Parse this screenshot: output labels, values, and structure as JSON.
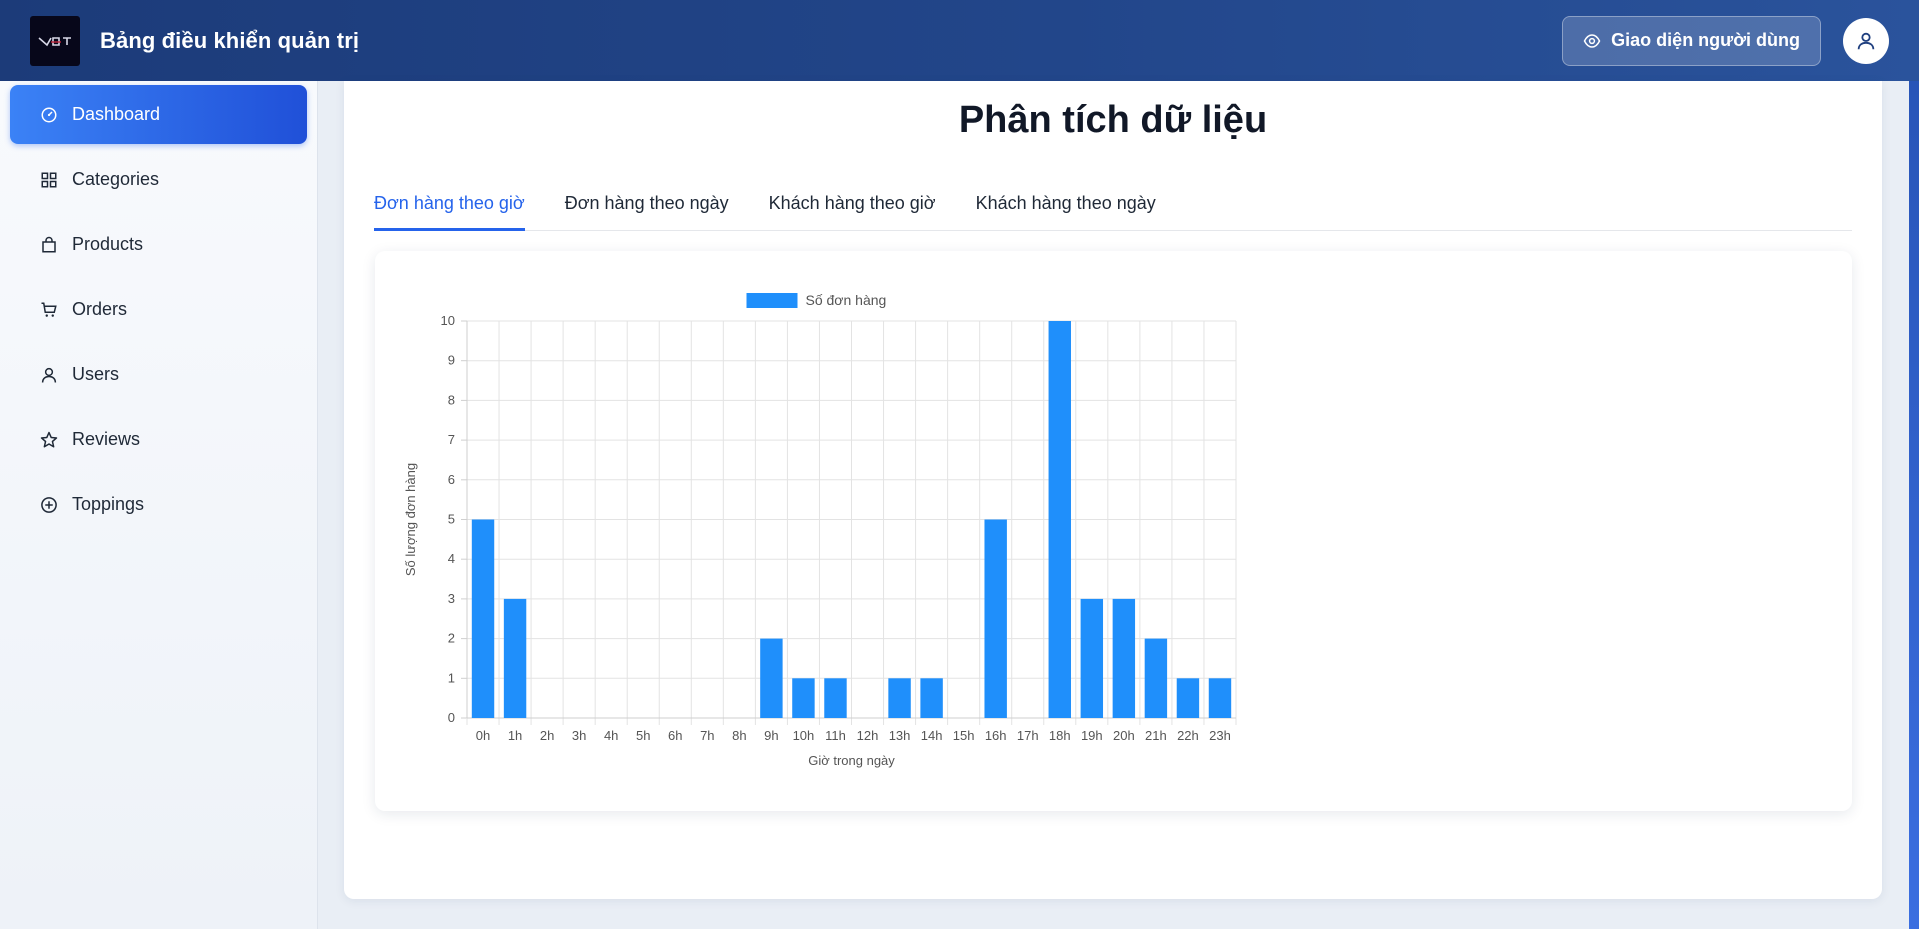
{
  "header": {
    "title": "Bảng điều khiển quản trị",
    "user_view_label": "Giao diện người dùng"
  },
  "sidebar": {
    "items": [
      {
        "label": "Dashboard",
        "icon": "dashboard-gauge-icon",
        "active": true
      },
      {
        "label": "Categories",
        "icon": "grid-icon",
        "active": false
      },
      {
        "label": "Products",
        "icon": "shopping-bag-icon",
        "active": false
      },
      {
        "label": "Orders",
        "icon": "cart-icon",
        "active": false
      },
      {
        "label": "Users",
        "icon": "user-icon",
        "active": false
      },
      {
        "label": "Reviews",
        "icon": "star-icon",
        "active": false
      },
      {
        "label": "Toppings",
        "icon": "plus-circle-icon",
        "active": false
      }
    ]
  },
  "main": {
    "title": "Phân tích dữ liệu",
    "tabs": [
      {
        "label": "Đơn hàng theo giờ",
        "active": true
      },
      {
        "label": "Đơn hàng theo ngày",
        "active": false
      },
      {
        "label": "Khách hàng theo giờ",
        "active": false
      },
      {
        "label": "Khách hàng theo ngày",
        "active": false
      }
    ]
  },
  "colors": {
    "accent": "#2563eb",
    "bar": "#1f8ffb",
    "header": "#1f3f7f"
  },
  "chart_data": {
    "type": "bar",
    "categories": [
      "0h",
      "1h",
      "2h",
      "3h",
      "4h",
      "5h",
      "6h",
      "7h",
      "8h",
      "9h",
      "10h",
      "11h",
      "12h",
      "13h",
      "14h",
      "15h",
      "16h",
      "17h",
      "18h",
      "19h",
      "20h",
      "21h",
      "22h",
      "23h"
    ],
    "series": [
      {
        "name": "Số đơn hàng",
        "values": [
          5,
          3,
          0,
          0,
          0,
          0,
          0,
          0,
          0,
          2,
          1,
          1,
          0,
          1,
          1,
          0,
          5,
          0,
          10,
          3,
          3,
          2,
          1,
          1
        ]
      }
    ],
    "xlabel": "Giờ trong ngày",
    "ylabel": "Số lượng đơn hàng",
    "ylim": [
      0,
      10
    ],
    "yticks": [
      0,
      1,
      2,
      3,
      4,
      5,
      6,
      7,
      8,
      9,
      10
    ],
    "grid": true,
    "legend": "top"
  }
}
